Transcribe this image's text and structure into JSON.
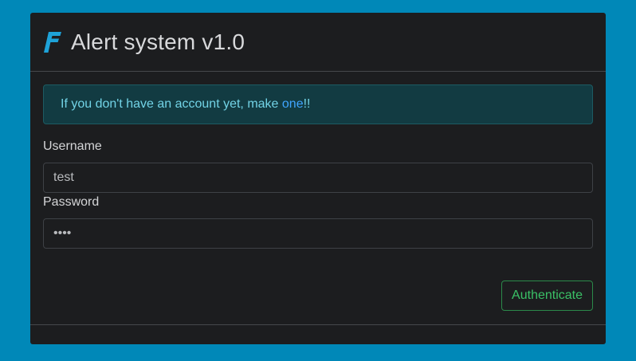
{
  "header": {
    "logo_icon": "brand-f-icon",
    "title": "Alert system v1.0"
  },
  "alert": {
    "text_before": "If you don't have an account yet, make ",
    "link_text": "one",
    "text_after": "!!"
  },
  "form": {
    "username_label": "Username",
    "username_value": "test",
    "password_label": "Password",
    "password_value": "test",
    "submit_label": "Authenticate"
  },
  "colors": {
    "page_background": "#0088b8",
    "card_background": "#1c1d1f",
    "alert_text": "#72d3e6",
    "link": "#3fa5ff",
    "button_success": "#3ac066",
    "logo": "#1ea2d8"
  }
}
